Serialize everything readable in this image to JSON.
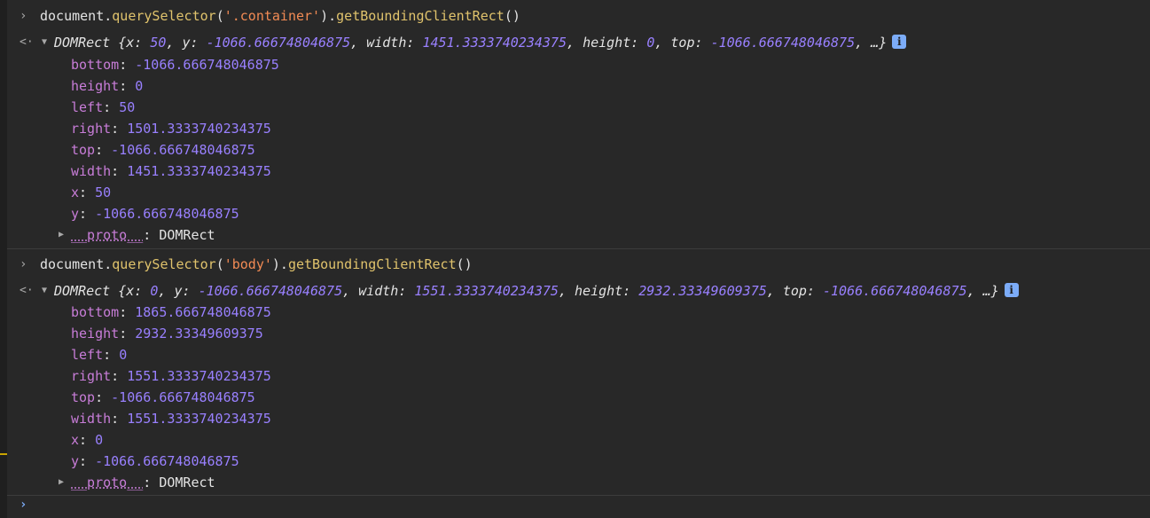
{
  "entries": [
    {
      "prompt": "›",
      "command": {
        "obj": "document.",
        "fn1": "querySelector",
        "open": "(",
        "arg": "'.container'",
        "close": ").",
        "fn2": "getBoundingClientRect",
        "tail": "()"
      },
      "result_arrow": "<·",
      "summary": {
        "type": "DOMRect",
        "open": "{",
        "pairs": [
          {
            "key": "x: ",
            "val": "50",
            "sep": ", "
          },
          {
            "key": "y: ",
            "val": "-1066.666748046875",
            "sep": ", "
          },
          {
            "key": "width: ",
            "val": "1451.3333740234375",
            "sep": ", "
          },
          {
            "key": "height: ",
            "val": "0",
            "sep": ", "
          },
          {
            "key": "top: ",
            "val": "-1066.666748046875",
            "sep": ", …}"
          }
        ],
        "info": "i"
      },
      "props": [
        {
          "key": "bottom",
          "val": "-1066.666748046875"
        },
        {
          "key": "height",
          "val": "0"
        },
        {
          "key": "left",
          "val": "50"
        },
        {
          "key": "right",
          "val": "1501.3333740234375"
        },
        {
          "key": "top",
          "val": "-1066.666748046875"
        },
        {
          "key": "width",
          "val": "1451.3333740234375"
        },
        {
          "key": "x",
          "val": "50"
        },
        {
          "key": "y",
          "val": "-1066.666748046875"
        }
      ],
      "proto": {
        "key": "__proto__",
        "val": "DOMRect"
      }
    },
    {
      "prompt": "›",
      "command": {
        "obj": "document.",
        "fn1": "querySelector",
        "open": "(",
        "arg": "'body'",
        "close": ").",
        "fn2": "getBoundingClientRect",
        "tail": "()"
      },
      "result_arrow": "<·",
      "summary": {
        "type": "DOMRect",
        "open": "{",
        "pairs": [
          {
            "key": "x: ",
            "val": "0",
            "sep": ", "
          },
          {
            "key": "y: ",
            "val": "-1066.666748046875",
            "sep": ", "
          },
          {
            "key": "width: ",
            "val": "1551.3333740234375",
            "sep": ", "
          },
          {
            "key": "height: ",
            "val": "2932.33349609375",
            "sep": ", "
          },
          {
            "key": "top: ",
            "val": "-1066.666748046875",
            "sep": ", …}"
          }
        ],
        "info": "i"
      },
      "props": [
        {
          "key": "bottom",
          "val": "1865.666748046875"
        },
        {
          "key": "height",
          "val": "2932.33349609375"
        },
        {
          "key": "left",
          "val": "0"
        },
        {
          "key": "right",
          "val": "1551.3333740234375"
        },
        {
          "key": "top",
          "val": "-1066.666748046875"
        },
        {
          "key": "width",
          "val": "1551.3333740234375"
        },
        {
          "key": "x",
          "val": "0"
        },
        {
          "key": "y",
          "val": "-1066.666748046875"
        }
      ],
      "proto": {
        "key": "__proto__",
        "val": "DOMRect"
      }
    }
  ],
  "input": {
    "prompt": "›"
  },
  "colors": {
    "background": "#282828",
    "string": "#f28b54",
    "function": "#e0c36c",
    "property_key": "#c87dd8",
    "number": "#9980ff",
    "info_badge": "#7cacf8"
  },
  "icons": {
    "prompt": "chevron-right-icon",
    "result": "result-return-icon",
    "expand": "triangle-down-icon",
    "collapse": "triangle-right-icon",
    "info": "info-icon"
  }
}
